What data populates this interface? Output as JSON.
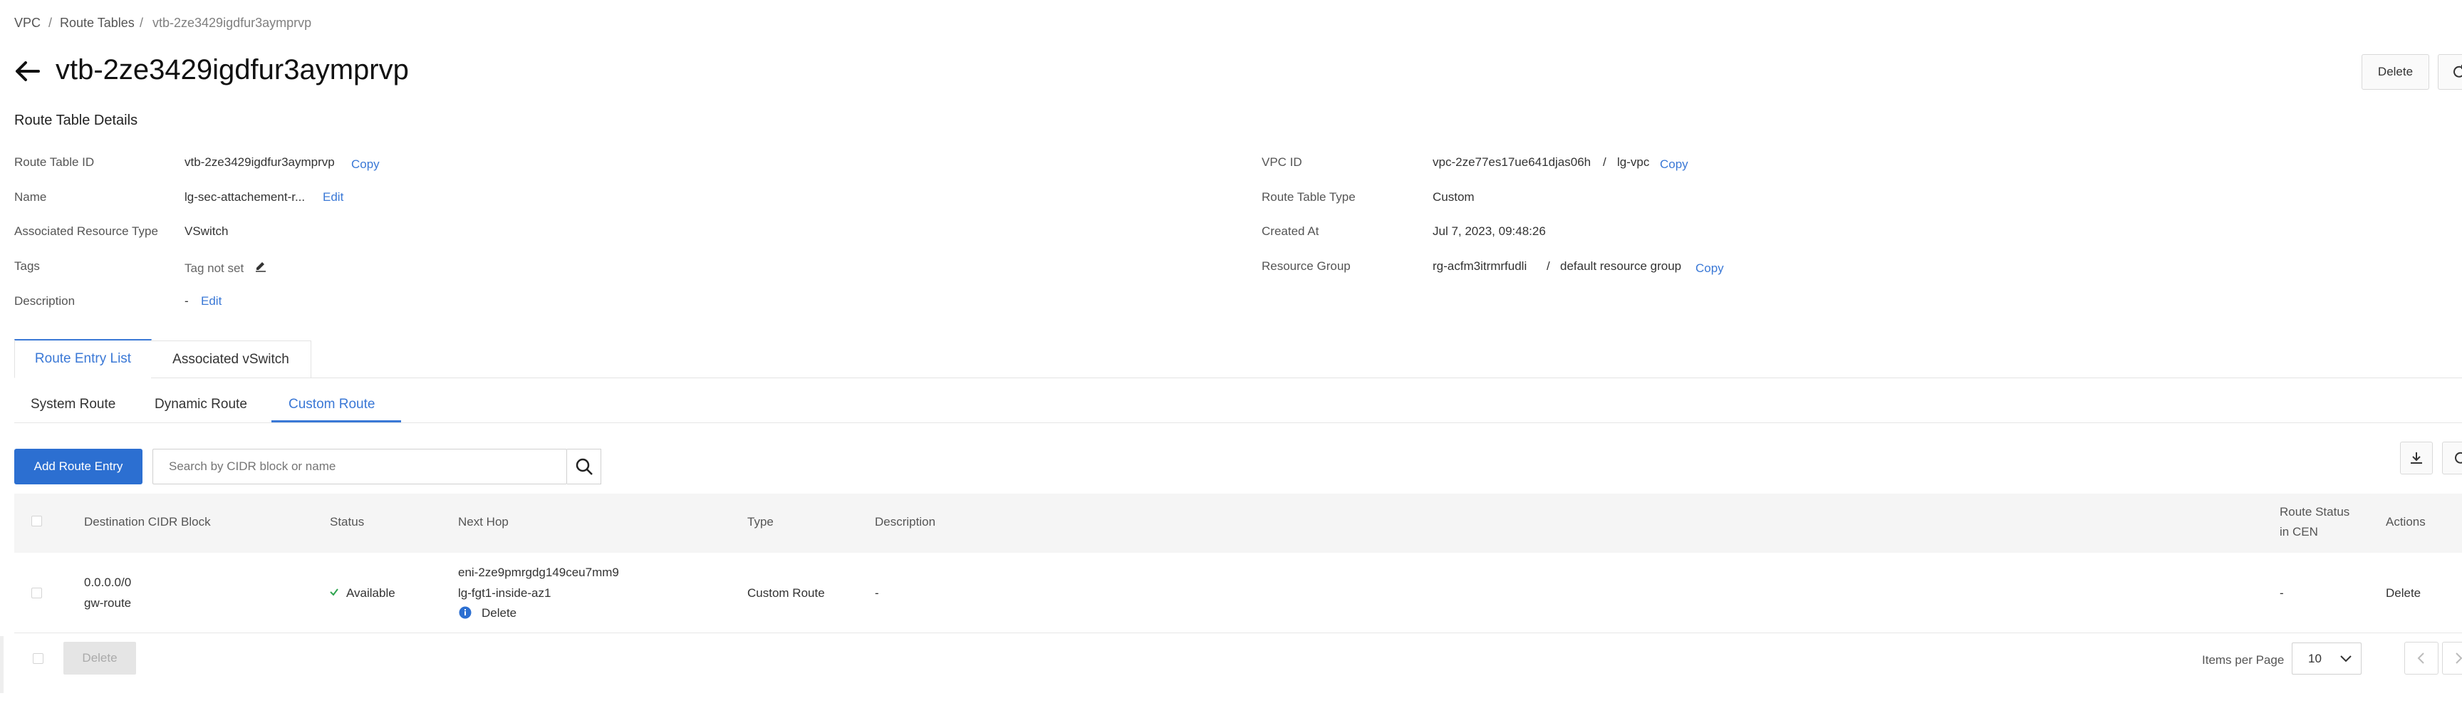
{
  "breadcrumb": {
    "items": [
      "VPC",
      "Route Tables",
      "vtb-2ze3429igdfur3aymprvp"
    ],
    "separator": "/"
  },
  "page_title": "vtb-2ze3429igdfur3aymprvp",
  "header_actions": {
    "delete_label": "Delete"
  },
  "section_title": "Route Table Details",
  "details": {
    "route_table_id": {
      "label": "Route Table ID",
      "value": "vtb-2ze3429igdfur3aymprvp",
      "copy": "Copy"
    },
    "name": {
      "label": "Name",
      "value": "lg-sec-attachement-r...",
      "edit": "Edit"
    },
    "associated_resource_type": {
      "label": "Associated Resource Type",
      "value": "VSwitch"
    },
    "tags": {
      "label": "Tags",
      "value": "Tag not set"
    },
    "description": {
      "label": "Description",
      "value": "-",
      "edit": "Edit"
    },
    "vpc_id": {
      "label": "VPC ID",
      "link": "vpc-2ze77es17ue641djas06h",
      "sep": "/",
      "name": "lg-vpc",
      "copy": "Copy"
    },
    "route_table_type": {
      "label": "Route Table Type",
      "value": "Custom"
    },
    "created_at": {
      "label": "Created At",
      "value": "Jul 7, 2023, 09:48:26"
    },
    "resource_group": {
      "label": "Resource Group",
      "link": "rg-acfm3itrmrfudli",
      "sep": "/",
      "name": "default resource group",
      "copy": "Copy"
    }
  },
  "main_tabs": [
    "Route Entry List",
    "Associated vSwitch"
  ],
  "sub_tabs": [
    "System Route",
    "Dynamic Route",
    "Custom Route"
  ],
  "toolbar": {
    "add_label": "Add Route Entry",
    "search_placeholder": "Search by CIDR block or name"
  },
  "table": {
    "headers": {
      "destination": "Destination CIDR Block",
      "status": "Status",
      "next_hop": "Next Hop",
      "type": "Type",
      "description": "Description",
      "cen_status_line1": "Route Status",
      "cen_status_line2": "in CEN",
      "actions": "Actions"
    },
    "rows": [
      {
        "destination": "0.0.0.0/0",
        "name": "gw-route",
        "status": "Available",
        "next_hop_link": "eni-2ze9pmrgdg149ceu7mm9",
        "next_hop_name": "lg-fgt1-inside-az1",
        "next_hop_delete": "Delete",
        "type": "Custom Route",
        "description": "-",
        "cen_status": "-",
        "action": "Delete"
      }
    ]
  },
  "footer": {
    "delete_label": "Delete",
    "items_per_page_label": "Items per Page",
    "items_per_page_value": "10"
  },
  "colors": {
    "accent": "#3a78d6",
    "primary_button": "#2c6fd1",
    "success": "#2ea44f"
  }
}
